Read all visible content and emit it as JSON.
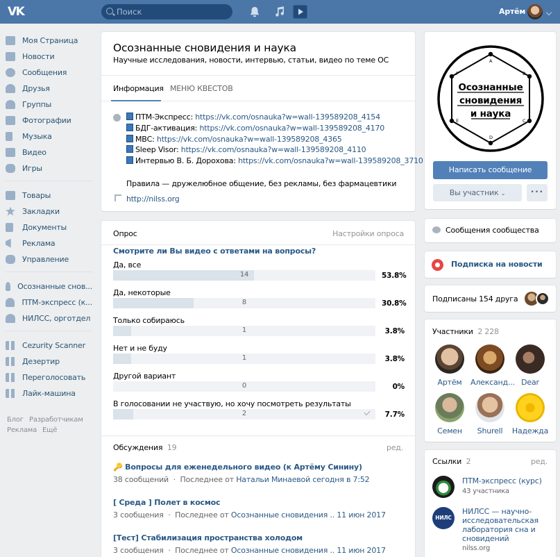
{
  "header": {
    "logo": "VK",
    "search_placeholder": "Поиск",
    "user_name": "Артём"
  },
  "icons": {
    "notifications": "bell-icon",
    "music": "music-icon",
    "video": "play-icon"
  },
  "sidebar": {
    "main": [
      "Моя Страница",
      "Новости",
      "Сообщения",
      "Друзья",
      "Группы",
      "Фотографии",
      "Музыка",
      "Видео",
      "Игры"
    ],
    "extra": [
      "Товары",
      "Закладки",
      "Документы",
      "Реклама",
      "Управление"
    ],
    "groups": [
      "Осознанные снов...",
      "ПТМ-экспресс (к...",
      "НИЛСС, орготдел"
    ],
    "apps": [
      "Cezurity Scanner",
      "Дезертир",
      "Переголосовать",
      "Лайк-машина"
    ],
    "footer": [
      "Блог",
      "Разработчикам",
      "Реклама",
      "Ещё"
    ]
  },
  "community": {
    "title": "Осознанные сновидения и наука",
    "subtitle": "Научные исследования, новости, интервью, статьи, видео по теме ОС",
    "tabs": [
      "Информация",
      "МЕНЮ КВЕСТОВ"
    ],
    "links": [
      {
        "label": "ПТМ-Экспресс: ",
        "url": "https://vk.com/osnauka?w=wall-139589208_4154"
      },
      {
        "label": "БДГ-активация: ",
        "url": "https://vk.com/osnauka?w=wall-139589208_4170"
      },
      {
        "label": "МВС: ",
        "url": "https://vk.com/osnauka?w=wall-139589208_4365"
      },
      {
        "label": "Sleep Visor: ",
        "url": "https://vk.com/osnauka?w=wall-139589208_4110"
      },
      {
        "label": "Интервью В. Б. Дорохова: ",
        "url": "https://vk.com/osnauka?w=wall-139589208_3710"
      }
    ],
    "rules": "Правила — дружелюбное общение, без рекламы, без фармацевтики",
    "site": "http://nilss.org"
  },
  "poll": {
    "header": "Опрос",
    "settings": "Настройки опроса",
    "question": "Смотрите ли Вы видео с ответами на вопросы?",
    "options": [
      {
        "label": "Да, все",
        "count": "14",
        "pct": "53.8%",
        "fraction": 0.538
      },
      {
        "label": "Да, некоторые",
        "count": "8",
        "pct": "30.8%",
        "fraction": 0.308
      },
      {
        "label": "Только собираюсь",
        "count": "1",
        "pct": "3.8%",
        "fraction": 0.038
      },
      {
        "label": "Нет и не буду",
        "count": "1",
        "pct": "3.8%",
        "fraction": 0.038
      },
      {
        "label": "Другой вариант",
        "count": "0",
        "pct": "0%",
        "fraction": 0
      },
      {
        "label": "В голосовании не участвую, но хочу посмотреть результаты",
        "count": "2",
        "pct": "7.7%",
        "fraction": 0.077,
        "voted": true
      }
    ]
  },
  "discussions": {
    "title": "Обсуждения",
    "count": "19",
    "edit": "ред.",
    "items": [
      {
        "title": "Вопросы для еженедельного видео (к Артёму Синину)",
        "count": "38 сообщений",
        "last_prefix": "Последнее от ",
        "last": "Натальи Минаевой сегодня в 7:52"
      },
      {
        "title": "[ Среда ] Полет в космос",
        "count": "3 сообщения",
        "last_prefix": "Последнее от ",
        "last": "Осознанные сновидения .. 11 июн 2017"
      },
      {
        "title": "[Тест] Стабилизация пространства холодом",
        "count": "3 сообщения",
        "last_prefix": "Последнее от ",
        "last": "Осознанные сновидения .. 11 июн 2017"
      }
    ]
  },
  "right": {
    "logo_text": [
      "Осознанные",
      "сновидения",
      "и наука"
    ],
    "logo_letters": [
      "A",
      "B",
      "C",
      "D",
      "E",
      "F"
    ],
    "write_button": "Написать сообщение",
    "member_button": "Вы участник",
    "more_button": "•••",
    "messages": "Сообщения сообщества",
    "subscribe": "Подписка на новости",
    "friends": "Подписаны 154 друга",
    "members_title": "Участники",
    "members_count": "2 228",
    "members": [
      "Артём",
      "Александ...",
      "Dear",
      "Семен",
      "Shurell",
      "Надежда"
    ],
    "links_title": "Ссылки",
    "links_count": "2",
    "links_edit": "ред.",
    "links": [
      {
        "title": "ПТМ-экспресс (курс)",
        "sub": "43 участника"
      },
      {
        "title": "НИЛСС — научно-исследовательская лаборатория сна и сновидений",
        "sub": "nilss.org"
      }
    ],
    "colors": {
      "accent": "#5181b8",
      "header": "#4a76a8",
      "subscribe": "#e64646"
    }
  }
}
